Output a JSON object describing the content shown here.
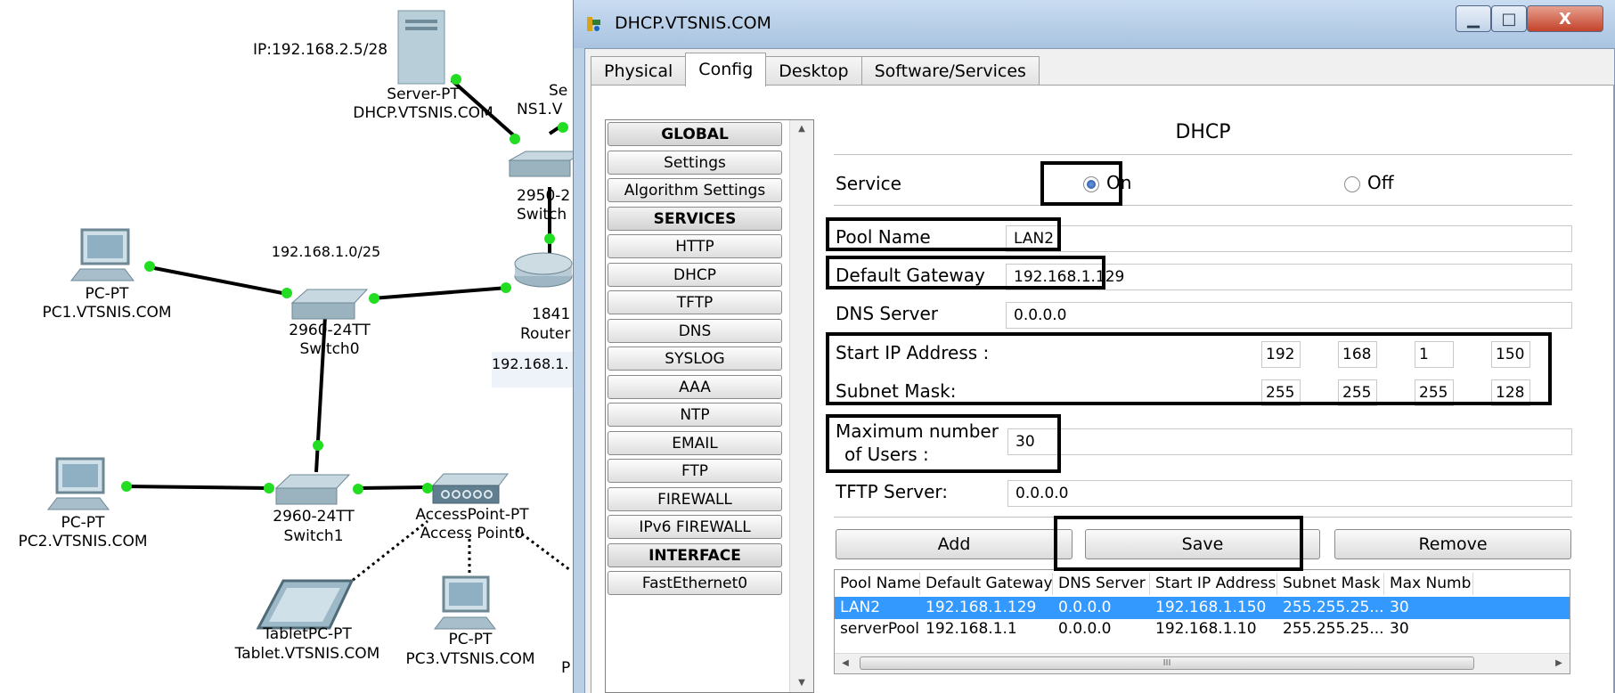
{
  "topology": {
    "server_ip_label": "IP:192.168.2.5/28",
    "server_type": "Server-PT",
    "server_name": "DHCP.VTSNIS.COM",
    "server2_type_partial": "Se",
    "server2_name_partial": "NS1.V",
    "switch2950_label": "2950-2",
    "switch2950_name": "Switch",
    "net1_label": "192.168.1.0/25",
    "router_label": "1841",
    "router_name": "Router",
    "router_ip_partial": "192.168.1.",
    "pc1_type": "PC-PT",
    "pc1_name": "PC1.VTSNIS.COM",
    "switch0_type": "2960-24TT",
    "switch0_name": "Switch0",
    "pc2_type": "PC-PT",
    "pc2_name": "PC2.VTSNIS.COM",
    "switch1_type": "2960-24TT",
    "switch1_name": "Switch1",
    "ap_type": "AccessPoint-PT",
    "ap_name": "Access Point0",
    "tablet_type": "TabletPC-PT",
    "tablet_name": "Tablet.VTSNIS.COM",
    "pc3_type": "PC-PT",
    "pc3_name": "PC3.VTSNIS.COM",
    "partial_p": "P"
  },
  "window": {
    "title": "DHCP.VTSNIS.COM",
    "min_glyph": "▁",
    "max_glyph": "□",
    "close_glyph": "X"
  },
  "tabs": [
    "Physical",
    "Config",
    "Desktop",
    "Software/Services"
  ],
  "nav": [
    {
      "label": "GLOBAL",
      "header": true
    },
    {
      "label": "Settings",
      "header": false
    },
    {
      "label": "Algorithm Settings",
      "header": false
    },
    {
      "label": "SERVICES",
      "header": true
    },
    {
      "label": "HTTP",
      "header": false
    },
    {
      "label": "DHCP",
      "header": false
    },
    {
      "label": "TFTP",
      "header": false
    },
    {
      "label": "DNS",
      "header": false
    },
    {
      "label": "SYSLOG",
      "header": false
    },
    {
      "label": "AAA",
      "header": false
    },
    {
      "label": "NTP",
      "header": false
    },
    {
      "label": "EMAIL",
      "header": false
    },
    {
      "label": "FTP",
      "header": false
    },
    {
      "label": "FIREWALL",
      "header": false
    },
    {
      "label": "IPv6 FIREWALL",
      "header": false
    },
    {
      "label": "INTERFACE",
      "header": true
    },
    {
      "label": "FastEthernet0",
      "header": false
    }
  ],
  "dhcp": {
    "heading": "DHCP",
    "service_label": "Service",
    "on_label": "On",
    "off_label": "Off",
    "service_on": true,
    "pool_name_label": "Pool Name",
    "pool_name_value": "LAN2",
    "gateway_label": "Default Gateway",
    "gateway_value": "192.168.1.129",
    "dns_label": "DNS Server",
    "dns_value": "0.0.0.0",
    "start_ip_label": "Start IP Address :",
    "start_ip": [
      "192",
      "168",
      "1",
      "150"
    ],
    "subnet_label": "Subnet Mask:",
    "subnet": [
      "255",
      "255",
      "255",
      "128"
    ],
    "max_users_label_1": "Maximum number",
    "max_users_label_2": "of Users :",
    "max_users_value": "30",
    "tftp_label": "TFTP Server:",
    "tftp_value": "0.0.0.0",
    "add_button": "Add",
    "save_button": "Save",
    "remove_button": "Remove"
  },
  "pool_table": {
    "columns": [
      "Pool Name",
      "Default Gateway",
      "DNS Server",
      "Start IP Address",
      "Subnet Mask",
      "Max Numb"
    ],
    "rows": [
      {
        "cells": [
          "LAN2",
          "192.168.1.129",
          "0.0.0.0",
          "192.168.1.150",
          "255.255.25...",
          "30"
        ],
        "selected": true
      },
      {
        "cells": [
          "serverPool",
          "192.168.1.1",
          "0.0.0.0",
          "192.168.1.10",
          "255.255.25...",
          "30"
        ],
        "selected": false
      }
    ],
    "scroll_thumb_glyph": "III"
  },
  "colors": {
    "selection": "#3399ff",
    "link_dot": "#22dd22",
    "highlight_box": "#000000"
  }
}
